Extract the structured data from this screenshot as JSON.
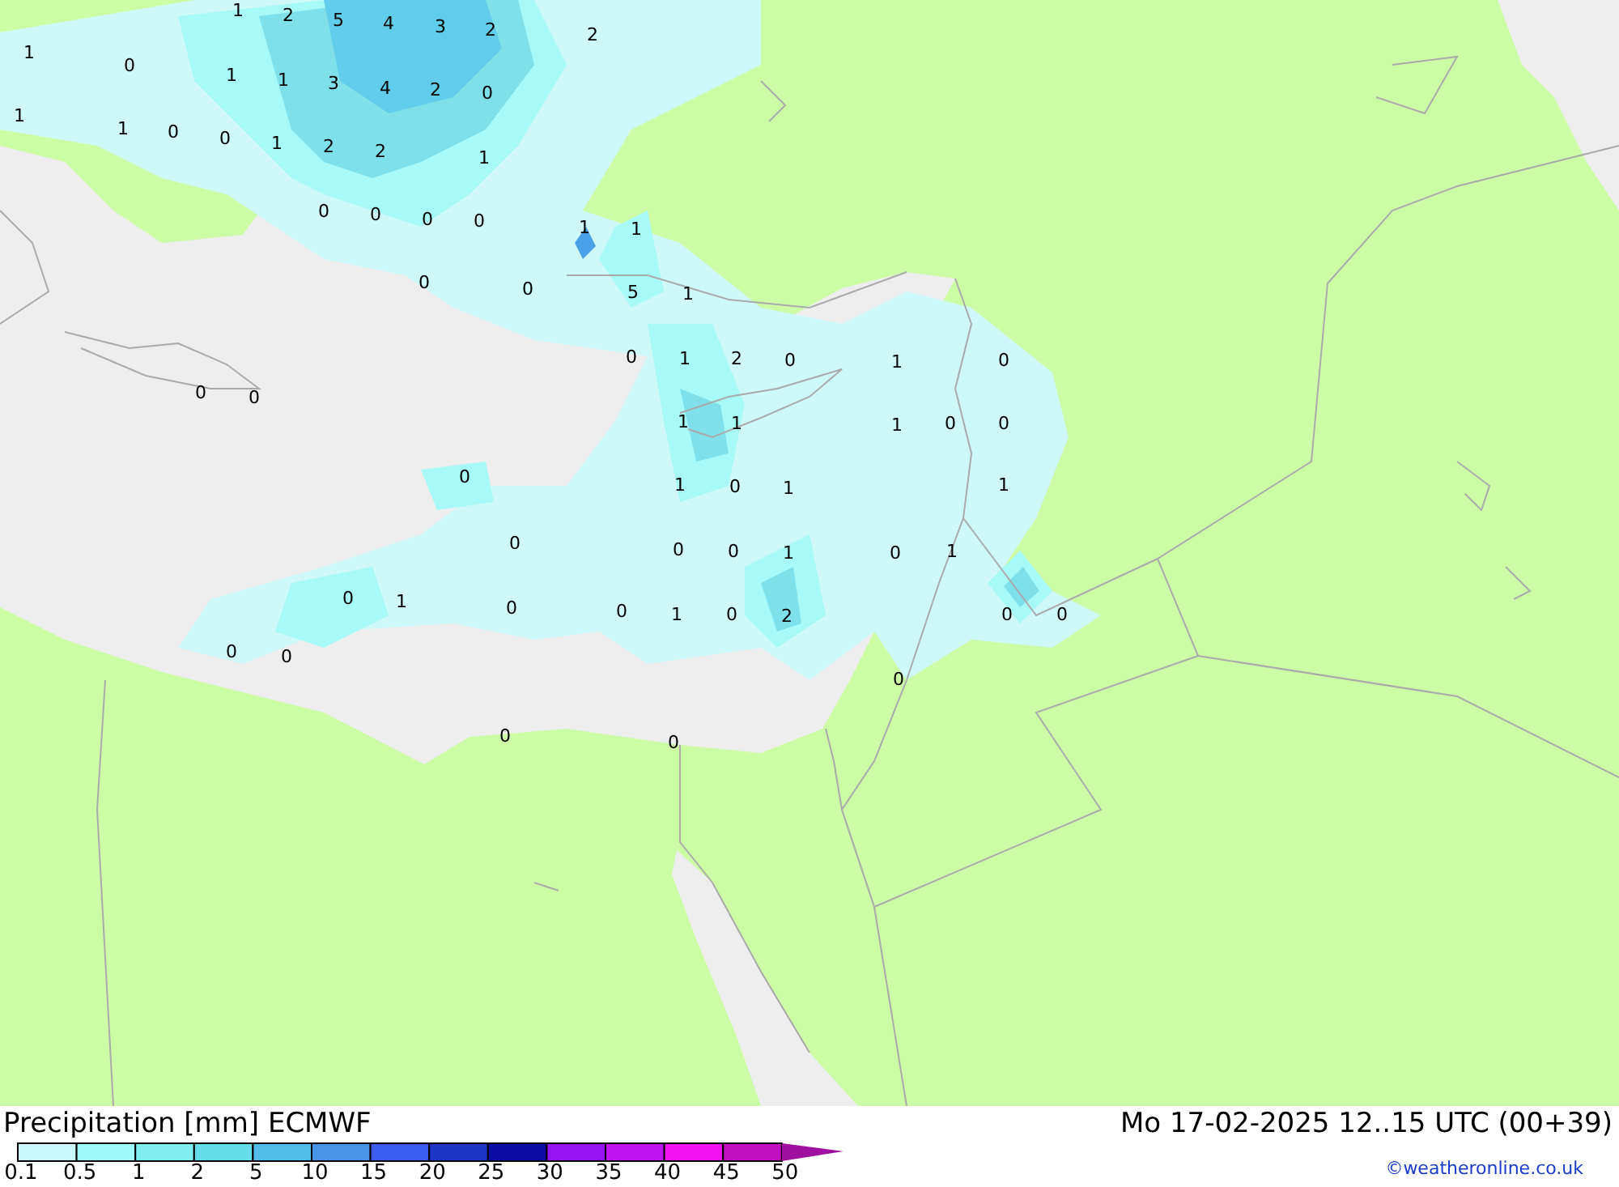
{
  "map": {
    "grid_values": [
      "1",
      "2",
      "5",
      "4",
      "3",
      "2",
      "2",
      "1",
      "0",
      "1",
      "1",
      "3",
      "4",
      "2",
      "0",
      "1",
      "1",
      "0",
      "0",
      "1",
      "2",
      "2",
      "1",
      "0",
      "0",
      "0",
      "0",
      "1",
      "1",
      "0",
      "0",
      "5",
      "1",
      "0",
      "1",
      "2",
      "0",
      "1",
      "0",
      "0",
      "0",
      "1",
      "1",
      "1",
      "0",
      "0",
      "0",
      "1",
      "0",
      "1",
      "1",
      "0",
      "0",
      "0",
      "1",
      "0",
      "1",
      "0",
      "1",
      "0",
      "0",
      "1",
      "0",
      "2",
      "0",
      "0",
      "0",
      "0",
      "0",
      "0",
      "0"
    ]
  },
  "footer": {
    "title": "Precipitation [mm] ECMWF",
    "valid_time": "Mo 17-02-2025 12..15 UTC (00+39)",
    "credit": "©weatheronline.co.uk"
  },
  "legend": [
    {
      "label": "0.1",
      "color": "#c8f8f8"
    },
    {
      "label": "0.5",
      "color": "#a0fafa"
    },
    {
      "label": "1",
      "color": "#80eeee"
    },
    {
      "label": "2",
      "color": "#64dcea"
    },
    {
      "label": "5",
      "color": "#50bce8"
    },
    {
      "label": "10",
      "color": "#4a94e6"
    },
    {
      "label": "15",
      "color": "#3a5cec"
    },
    {
      "label": "20",
      "color": "#1e36c4"
    },
    {
      "label": "25",
      "color": "#0a0ca4"
    },
    {
      "label": "30",
      "color": "#9614f2"
    },
    {
      "label": "35",
      "color": "#c014f2"
    },
    {
      "label": "40",
      "color": "#f014f0"
    },
    {
      "label": "45",
      "color": "#c010c0"
    },
    {
      "label": "50",
      "color": "#a010a0"
    }
  ]
}
